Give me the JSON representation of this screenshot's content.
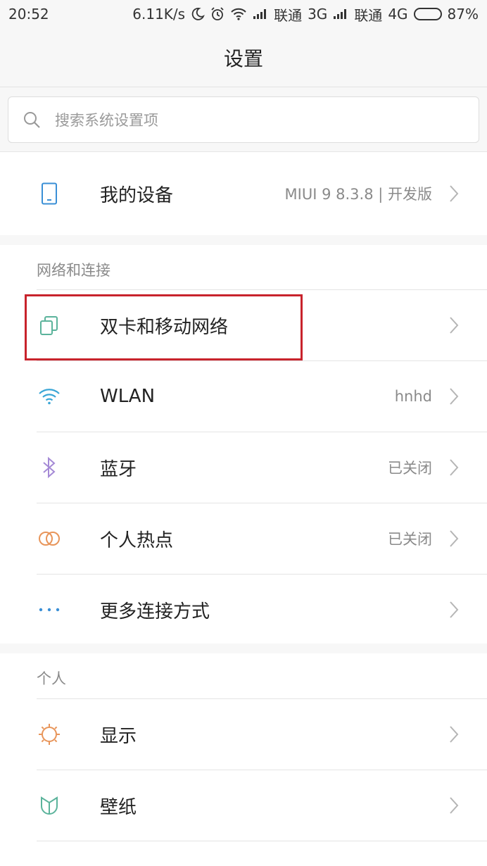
{
  "status_bar": {
    "time": "20:52",
    "speed": "6.11K/s",
    "carrier1": "联通",
    "net1": "3G",
    "carrier2": "联通",
    "net2": "4G",
    "battery": "87%",
    "battery_level": 0.87,
    "icons": [
      "moon-icon",
      "alarm-icon",
      "wifi-icon",
      "signal-icon",
      "signal-icon"
    ]
  },
  "header": {
    "title": "设置"
  },
  "search": {
    "placeholder": "搜索系统设置项"
  },
  "device": {
    "label": "我的设备",
    "value": "MIUI 9 8.3.8 | 开发版",
    "icon": "phone-icon"
  },
  "network_section": {
    "heading": "网络和连接",
    "items": [
      {
        "label": "双卡和移动网络",
        "value": "",
        "icon": "sim-cards-icon",
        "highlighted": true
      },
      {
        "label": "WLAN",
        "value": "hnhd",
        "icon": "wifi-icon"
      },
      {
        "label": "蓝牙",
        "value": "已关闭",
        "icon": "bluetooth-icon"
      },
      {
        "label": "个人热点",
        "value": "已关闭",
        "icon": "hotspot-icon"
      },
      {
        "label": "更多连接方式",
        "value": "",
        "icon": "more-dots-icon"
      }
    ]
  },
  "personal_section": {
    "heading": "个人",
    "items": [
      {
        "label": "显示",
        "value": "",
        "icon": "brightness-icon"
      },
      {
        "label": "壁纸",
        "value": "",
        "icon": "wallpaper-icon"
      }
    ]
  },
  "colors": {
    "highlight_border": "#c8232c",
    "sim_icon": "#5bb39b",
    "wifi_icon": "#3aa6d6",
    "bluetooth_icon": "#a58ad6",
    "hotspot_icon": "#e8955a",
    "more_icon": "#3a8fd6",
    "display_icon": "#e8955a",
    "wallpaper_icon": "#5bb39b",
    "device_icon": "#3a8fd6"
  }
}
